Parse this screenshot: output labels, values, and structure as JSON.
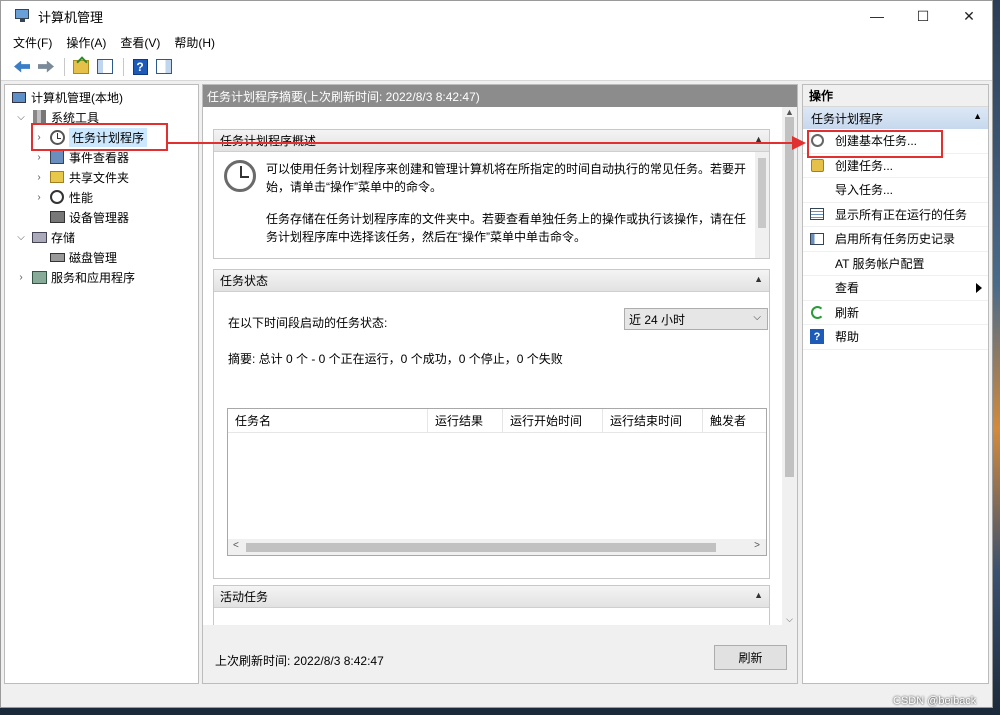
{
  "window": {
    "title": "计算机管理",
    "min": "—",
    "max": "☐",
    "close": "✕"
  },
  "menu": [
    "文件(F)",
    "操作(A)",
    "查看(V)",
    "帮助(H)"
  ],
  "tree": {
    "root": "计算机管理(本地)",
    "system_tools": "系统工具",
    "task_scheduler": "任务计划程序",
    "event_viewer": "事件查看器",
    "shared_folders": "共享文件夹",
    "performance": "性能",
    "device_manager": "设备管理器",
    "storage": "存储",
    "disk_management": "磁盘管理",
    "services_apps": "服务和应用程序"
  },
  "main": {
    "header": "任务计划程序摘要(上次刷新时间: 2022/8/3 8:42:47)",
    "overview": {
      "title": "任务计划程序概述",
      "para1": "可以使用任务计划程序来创建和管理计算机将在所指定的时间自动执行的常见任务。若要开始，请单击“操作”菜单中的命令。",
      "para2": "任务存储在任务计划程序库的文件夹中。若要查看单独任务上的操作或执行该操作，请在任务计划程序库中选择该任务，然后在“操作”菜单中单击命令。"
    },
    "status": {
      "title": "任务状态",
      "period_label": "在以下时间段启动的任务状态:",
      "period_value": "近 24 小时",
      "summary": "摘要: 总计 0 个 - 0 个正在运行，0 个成功，0 个停止，0 个失败",
      "columns": [
        "任务名",
        "运行结果",
        "运行开始时间",
        "运行结束时间",
        "触发者"
      ]
    },
    "active": {
      "title": "活动任务"
    },
    "footer_time": "上次刷新时间: 2022/8/3 8:42:47",
    "refresh_button": "刷新"
  },
  "actions": {
    "header": "操作",
    "section": "任务计划程序",
    "items": [
      "创建基本任务...",
      "创建任务...",
      "导入任务...",
      "显示所有正在运行的任务",
      "启用所有任务历史记录",
      "AT 服务帐户配置",
      "查看",
      "刷新",
      "帮助"
    ]
  },
  "watermark": "CSDN @beiback",
  "colors": {
    "annotation": "#e03030",
    "selection": "#cce8ff",
    "mid_header": "#8c8c8c"
  }
}
